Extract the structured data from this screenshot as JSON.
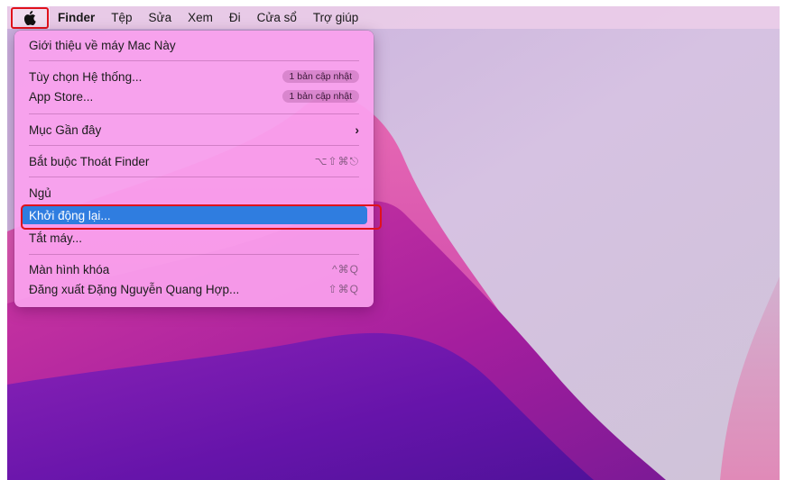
{
  "menubar": {
    "apple_icon": "apple-logo-icon",
    "items": [
      "Finder",
      "Tệp",
      "Sửa",
      "Xem",
      "Đi",
      "Cửa sổ",
      "Trợ giúp"
    ]
  },
  "apple_menu": {
    "about": "Giới thiệu về máy Mac Này",
    "system_prefs": "Tùy chọn Hệ thống...",
    "system_prefs_badge": "1 bản cập nhật",
    "app_store": "App Store...",
    "app_store_badge": "1 bản cập nhật",
    "recent_items": "Mục Gần đây",
    "recent_items_chevron": "›",
    "force_quit": "Bắt buộc Thoát Finder",
    "force_quit_shortcut": "⌥⇧⌘⎋",
    "sleep": "Ngủ",
    "restart": "Khởi động lại...",
    "shutdown": "Tắt máy...",
    "lock_screen": "Màn hình khóa",
    "lock_screen_shortcut": "^⌘Q",
    "logout": "Đăng xuất Đặng Nguyễn Quang Hợp...",
    "logout_shortcut": "⇧⌘Q"
  },
  "colors": {
    "selection": "#2f7de0",
    "highlight_box": "#e0121b",
    "menu_bg": "#faa0ee"
  }
}
